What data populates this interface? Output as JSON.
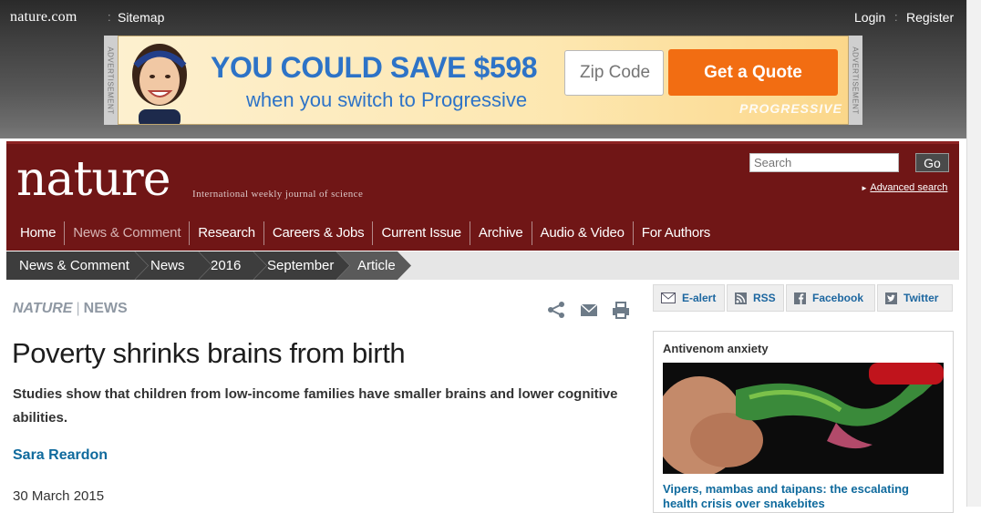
{
  "topbar": {
    "site_name": "nature.com",
    "sitemap": "Sitemap",
    "login": "Login",
    "register": "Register",
    "separator": ":"
  },
  "ad": {
    "side_label": "ADVERTISEMENT",
    "headline": "YOU COULD SAVE $598",
    "subline": "when you switch to Progressive",
    "zip_placeholder": "Zip Code",
    "cta": "Get a Quote",
    "brand": "PROGRESSIVE"
  },
  "masthead": {
    "logo": "nature",
    "tagline": "International weekly journal of science",
    "search_placeholder": "Search",
    "go": "Go",
    "advanced_search": "Advanced search",
    "nav": [
      "Home",
      "News & Comment",
      "Research",
      "Careers & Jobs",
      "Current Issue",
      "Archive",
      "Audio & Video",
      "For Authors"
    ],
    "active_nav": "News & Comment"
  },
  "breadcrumb": [
    "News & Comment",
    "News",
    "2016",
    "September",
    "Article"
  ],
  "article": {
    "journal": "NATURE",
    "section": "NEWS",
    "kicker_sep": "|",
    "title": "Poverty shrinks brains from birth",
    "standfirst": "Studies show that children from low-income families have smaller brains and lower cognitive abilities.",
    "author": "Sara Reardon",
    "date": "30 March 2015"
  },
  "tools": [
    "share-icon",
    "email-icon",
    "print-icon"
  ],
  "share": {
    "ealert": "E-alert",
    "rss": "RSS",
    "facebook": "Facebook",
    "twitter": "Twitter"
  },
  "feature": {
    "title": "Antivenom anxiety",
    "link": "Vipers, mambas and taipans: the escalating health crisis over snakebites"
  },
  "colors": {
    "masthead": "#701616",
    "breadcrumb": "#3d3d3d",
    "link": "#0f6a9d",
    "cta": "#f26d12",
    "ad_text": "#2d73c7"
  }
}
